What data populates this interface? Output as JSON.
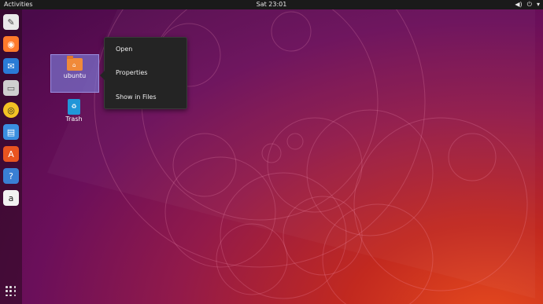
{
  "topbar": {
    "activities": "Activities",
    "clock": "Sat 23:01",
    "icons": [
      "volume-icon",
      "power-icon",
      "menu-arrow-icon"
    ]
  },
  "dock": {
    "items": [
      {
        "name": "text-editor-icon",
        "color": "#e9e9e9",
        "glyph": "✎"
      },
      {
        "name": "firefox-icon",
        "color": "#ff7a2b",
        "glyph": "◉"
      },
      {
        "name": "thunderbird-icon",
        "color": "#2a7bd6",
        "glyph": "✉"
      },
      {
        "name": "files-icon",
        "color": "#cfcfcf",
        "glyph": "▭"
      },
      {
        "name": "rhythmbox-icon",
        "color": "#f3c224",
        "glyph": "◎"
      },
      {
        "name": "libreoffice-writer-icon",
        "color": "#3a8ee0",
        "glyph": "▤"
      },
      {
        "name": "software-center-icon",
        "color": "#e95420",
        "glyph": "A"
      },
      {
        "name": "help-icon",
        "color": "#3a7fd4",
        "glyph": "?"
      },
      {
        "name": "amazon-icon",
        "color": "#f2f2f2",
        "glyph": "a"
      }
    ],
    "show_apps_icon": "show-applications-icon"
  },
  "desktop": {
    "folder": {
      "label": "ubuntu",
      "icon": "home-folder-icon"
    },
    "trash": {
      "label": "Trash",
      "icon": "trash-icon"
    }
  },
  "context_menu": {
    "items": [
      "Open",
      "Properties",
      "Show in Files"
    ]
  },
  "colors": {
    "accent": "#e95420",
    "menu_bg": "#242424",
    "topbar_bg": "#1a1a1a"
  }
}
